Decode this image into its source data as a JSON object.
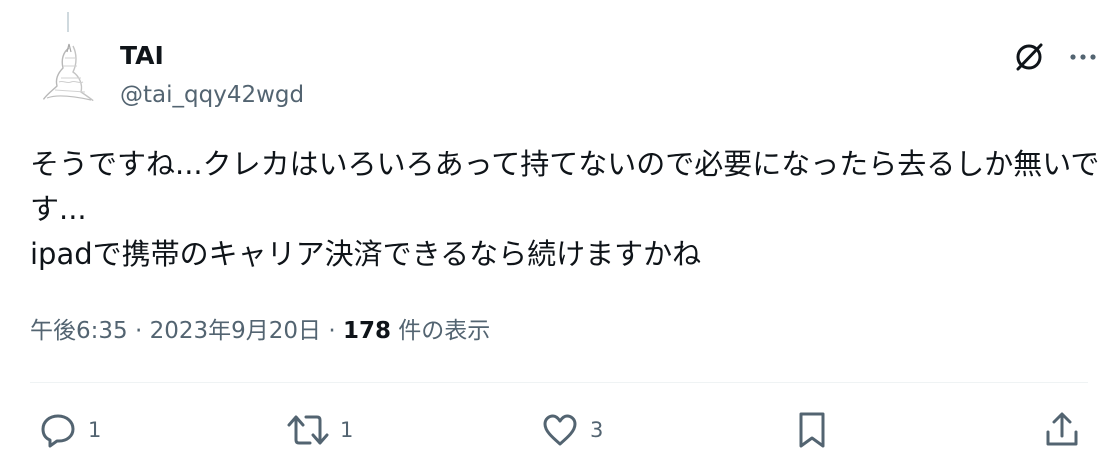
{
  "tweet": {
    "author": {
      "display_name": "TAI",
      "handle": "@tai_qqy42wgd",
      "avatar": "sketch-avatar-icon"
    },
    "text": "そうですね...クレカはいろいろあって持てないので必要になったら去るしか無いです...\nipadで携帯のキャリア決済できるなら続けますかね",
    "timestamp": "午後6:35 · 2023年9月20日",
    "separator": " · ",
    "views_count": "178",
    "views_label": " 件の表示",
    "replies": "1",
    "reposts": "1",
    "likes": "3"
  },
  "icons": {
    "grok": "grok-icon",
    "more": "more-icon",
    "reply": "reply-icon",
    "repost": "repost-icon",
    "like": "heart-icon",
    "bookmark": "bookmark-icon",
    "share": "share-icon"
  },
  "colors": {
    "text": "#0f1419",
    "secondary": "#536471",
    "divider": "#eff3f4"
  }
}
